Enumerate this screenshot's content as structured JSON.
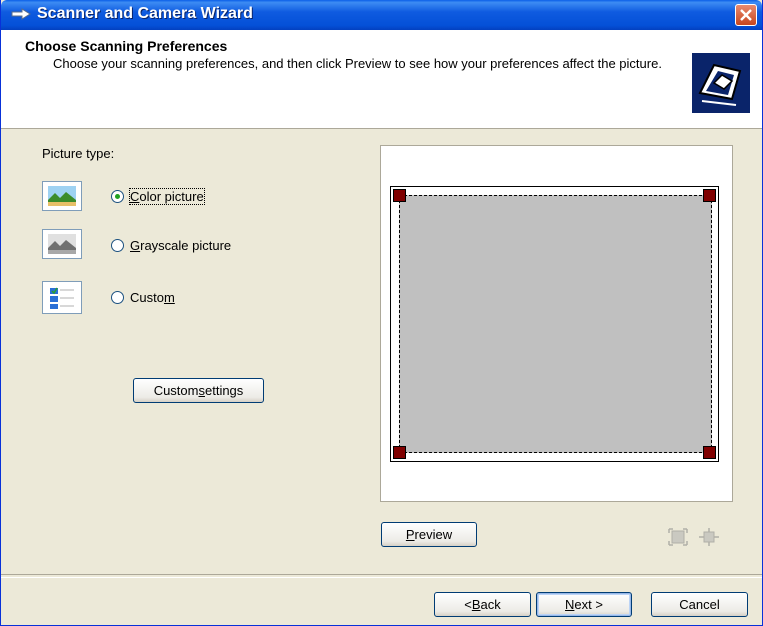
{
  "window": {
    "title": "Scanner and Camera Wizard"
  },
  "header": {
    "title": "Choose Scanning Preferences",
    "subtitle": "Choose your scanning preferences, and then click Preview to see how your preferences affect the picture."
  },
  "picture_type": {
    "label": "Picture type:",
    "options": [
      {
        "pre": "",
        "accel": "C",
        "post": "olor picture",
        "selected": true,
        "icon": "color-picture-icon"
      },
      {
        "pre": "",
        "accel": "G",
        "post": "rayscale picture",
        "selected": false,
        "icon": "grayscale-picture-icon"
      },
      {
        "pre": "Custo",
        "accel": "m",
        "post": "",
        "selected": false,
        "icon": "custom-picture-icon"
      }
    ]
  },
  "buttons": {
    "custom_settings": {
      "pre": "Custom ",
      "accel": "s",
      "post": "ettings"
    },
    "preview": {
      "pre": "",
      "accel": "P",
      "post": "review"
    },
    "back": {
      "pre": "< ",
      "accel": "B",
      "post": "ack"
    },
    "next": {
      "pre": "",
      "accel": "N",
      "post": "ext >"
    },
    "cancel": "Cancel"
  },
  "colors": {
    "titlebar": "#0450D7",
    "scan_area": "#C0C0C0",
    "handle": "#800000",
    "face": "#ECE9D8"
  }
}
